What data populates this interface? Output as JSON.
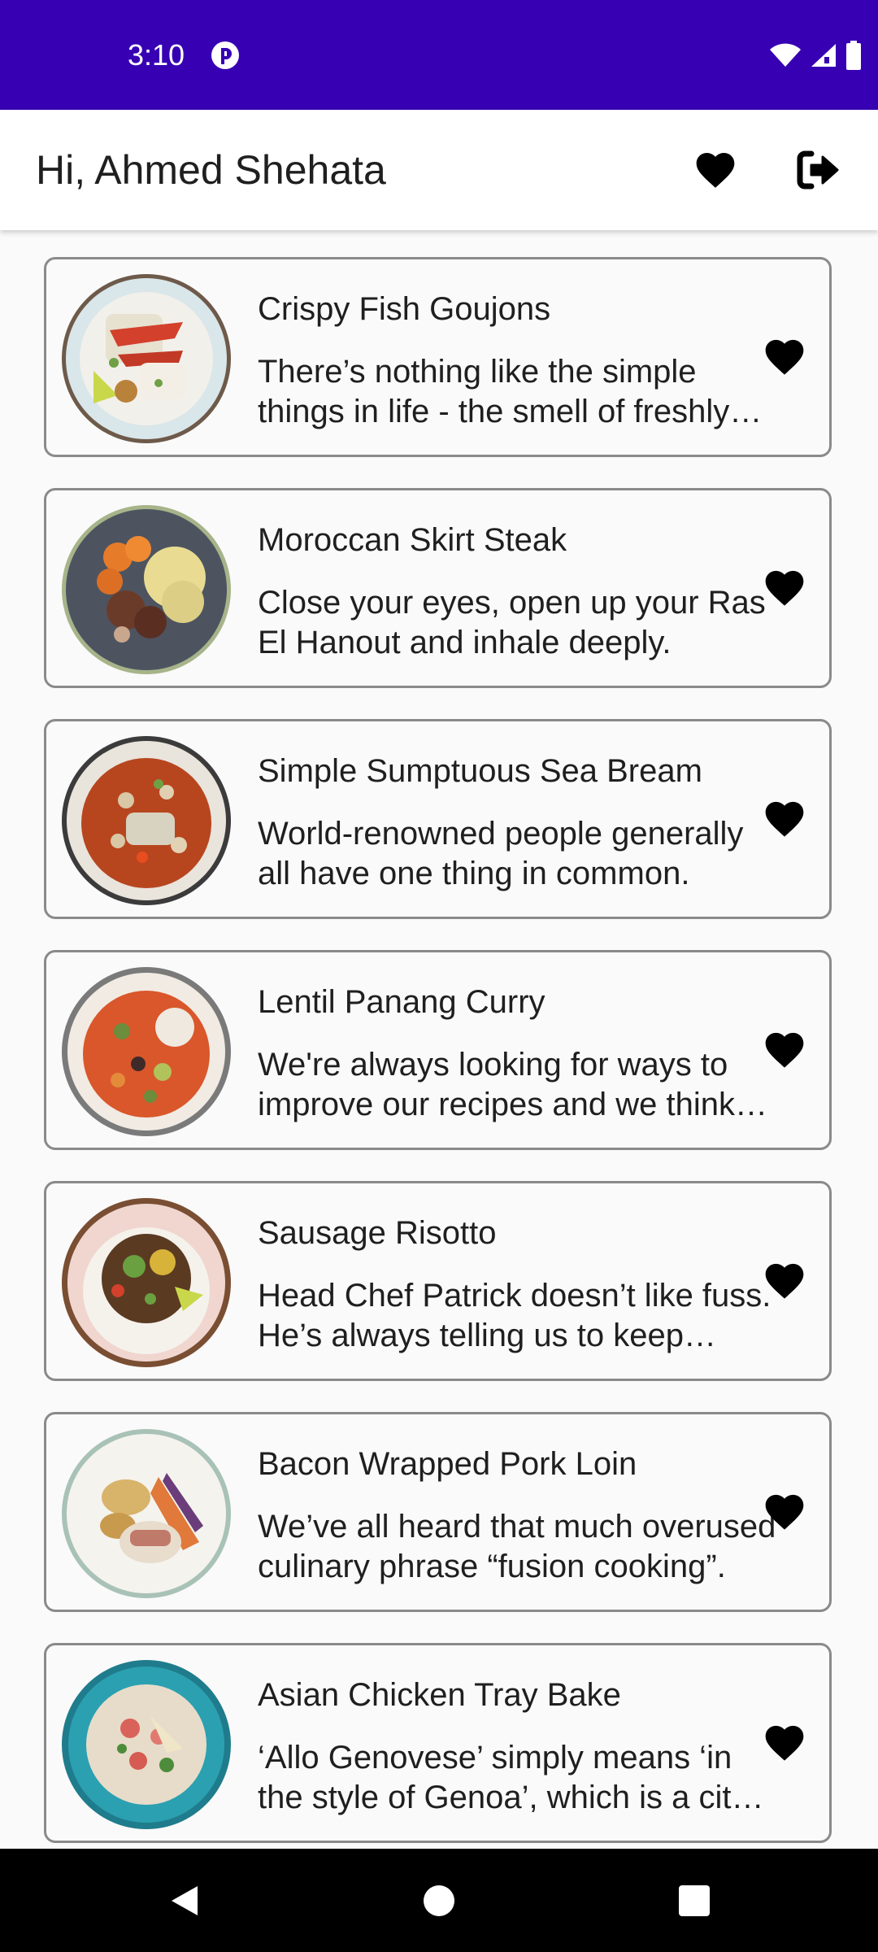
{
  "status_bar": {
    "time": "3:10",
    "icons": [
      "app-notification-icon",
      "wifi-icon",
      "cell-signal-icon",
      "battery-icon"
    ],
    "background": "#3700b3"
  },
  "header": {
    "greeting": "Hi, Ahmed Shehata",
    "favorites_icon": "heart-icon",
    "logout_icon": "logout-icon"
  },
  "meals": [
    {
      "title": "Crispy Fish Goujons",
      "description": "There’s nothing like the simple things in life - the smell of freshly cut grass, sitting outside on a nice sunny day, spending time with friends and family."
    },
    {
      "title": "Moroccan Skirt Steak",
      "description": "Close your eyes, open up your Ras El Hanout and inhale deeply."
    },
    {
      "title": "Simple Sumptuous Sea Bream",
      "description": "World-renowned people generally all have one thing in common."
    },
    {
      "title": "Lentil Panang Curry",
      "description": "We're always looking for ways to improve our recipes and we think we've found it."
    },
    {
      "title": "Sausage Risotto",
      "description": "Head Chef Patrick doesn’t like fuss. He’s always telling us to keep things simple."
    },
    {
      "title": "Bacon Wrapped Pork Loin",
      "description": "We’ve all heard that much overused culinary phrase “fusion cooking”."
    },
    {
      "title": "Asian Chicken Tray Bake",
      "description": "‘Allo Genovese’ simply means ‘in the style of Genoa’, which is a city in Italy."
    }
  ],
  "nav_bar": {
    "buttons": [
      "back-icon",
      "home-icon",
      "recents-icon"
    ]
  }
}
